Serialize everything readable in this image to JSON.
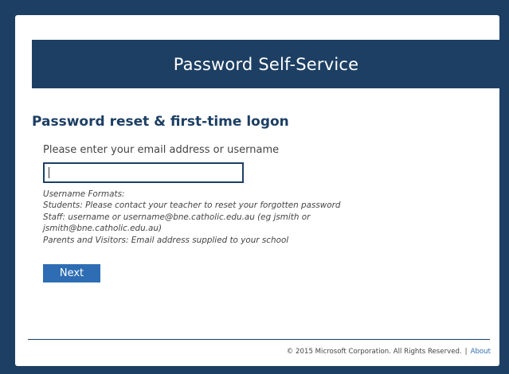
{
  "banner": {
    "title": "Password Self-Service"
  },
  "form": {
    "heading": "Password reset & first-time logon",
    "prompt": "Please enter your email address or username",
    "input_value": "",
    "formats": [
      "Username Formats:",
      "Students: Please contact your teacher to reset your forgotten password",
      "Staff: username or username@bne.catholic.edu.au (eg jsmith or",
      "jsmith@bne.catholic.edu.au)",
      "Parents and Visitors: Email address supplied to your school"
    ],
    "next_label": "Next"
  },
  "footer": {
    "copyright": "© 2015 Microsoft Corporation. All Rights Reserved.",
    "separator": "|",
    "about_label": "About"
  },
  "colors": {
    "brand_navy": "#1d3f63",
    "button_blue": "#2e6db4"
  }
}
